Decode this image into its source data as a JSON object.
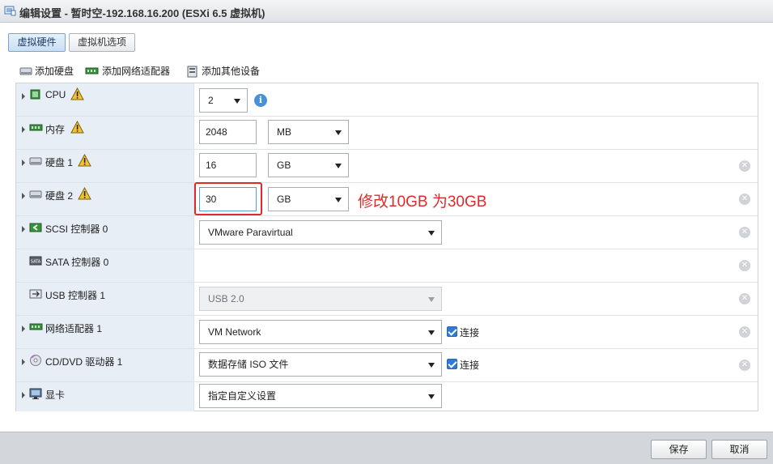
{
  "window": {
    "title": "编辑设置 - 暂时空-192.168.16.200 (ESXi 6.5 虚拟机)"
  },
  "tabs": [
    {
      "label": "虚拟硬件",
      "active": true
    },
    {
      "label": "虚拟机选项",
      "active": false
    }
  ],
  "toolbar": {
    "add_disk": "添加硬盘",
    "add_network": "添加网络适配器",
    "add_other": "添加其他设备"
  },
  "rows": {
    "cpu": {
      "label": "CPU",
      "value": "2"
    },
    "memory": {
      "label": "内存",
      "value": "2048",
      "unit": "MB"
    },
    "disk1": {
      "label": "硬盘 1",
      "value": "16",
      "unit": "GB"
    },
    "disk2": {
      "label": "硬盘 2",
      "value": "30",
      "unit": "GB"
    },
    "scsi": {
      "label": "SCSI 控制器 0",
      "value": "VMware Paravirtual"
    },
    "sata": {
      "label": "SATA 控制器 0"
    },
    "usb": {
      "label": "USB 控制器 1",
      "value": "USB 2.0"
    },
    "network": {
      "label": "网络适配器 1",
      "value": "VM Network",
      "connect_label": "连接",
      "connected": true
    },
    "cddvd": {
      "label": "CD/DVD 驱动器 1",
      "value": "数据存储 ISO 文件",
      "connect_label": "连接",
      "connected": true
    },
    "video": {
      "label": "显卡",
      "value": "指定自定义设置"
    }
  },
  "annotation": {
    "text": "修改10GB 为30GB",
    "color": "#e02a2a"
  },
  "footer": {
    "save": "保存",
    "cancel": "取消"
  },
  "colors": {
    "accent": "#4a90d9",
    "label_bg": "#e7eef5",
    "warning": "#f2c230"
  }
}
